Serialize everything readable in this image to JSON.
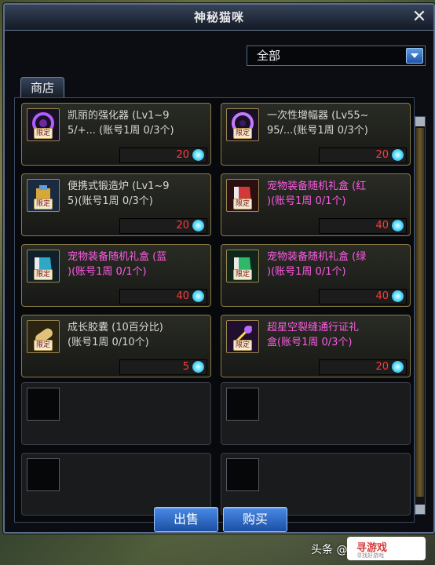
{
  "window": {
    "title": "神秘猫咪"
  },
  "filter": {
    "selected": "全部"
  },
  "tabs": [
    {
      "label": "商店"
    }
  ],
  "items": [
    {
      "name": "凯丽的强化器 (Lv1~9\n5/+... (账号1周 0/3个)",
      "price": "20",
      "highlight": false,
      "badge": "限定",
      "icon": "purple-orb-icon"
    },
    {
      "name": "一次性增幅器 (Lv55~\n95/...(账号1周 0/3个)",
      "price": "20",
      "highlight": false,
      "badge": "限定",
      "icon": "purple-orb-icon"
    },
    {
      "name": "便携式锻造炉 (Lv1~9\n5)(账号1周 0/3个)",
      "price": "20",
      "highlight": false,
      "badge": "限定",
      "icon": "forge-icon"
    },
    {
      "name": "宠物装备随机礼盒 (红\n)(账号1周 0/1个)",
      "price": "40",
      "highlight": true,
      "badge": "限定",
      "icon": "red-box-icon"
    },
    {
      "name": "宠物装备随机礼盒 (蓝\n)(账号1周 0/1个)",
      "price": "40",
      "highlight": true,
      "badge": "限定",
      "icon": "blue-box-icon"
    },
    {
      "name": "宠物装备随机礼盒 (绿\n)(账号1周 0/1个)",
      "price": "40",
      "highlight": true,
      "badge": "限定",
      "icon": "green-box-icon"
    },
    {
      "name": "成长胶囊 (10百分比)\n(账号1周 0/10个)",
      "price": "5",
      "highlight": false,
      "badge": "限定",
      "icon": "capsule-icon"
    },
    {
      "name": "超星空裂缝通行证礼\n盒(账号1周 0/3个)",
      "price": "20",
      "highlight": true,
      "badge": "限定",
      "icon": "star-ticket-icon"
    }
  ],
  "buttons": {
    "sell": "出售",
    "buy": "购买"
  },
  "watermark": {
    "source": "头条 @",
    "brand": "寻游戏",
    "tagline": "寻找好游戏"
  },
  "colors": {
    "accent": "#2f6fd0",
    "price": "#ff3b3b",
    "highlight_name": "#ff5ce6",
    "currency": "#5ee0ff"
  }
}
